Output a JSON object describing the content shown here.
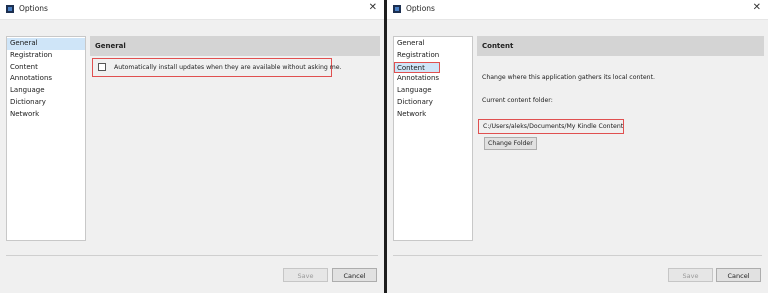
{
  "left_window": {
    "title": "Options",
    "icon": "kindle-app-icon",
    "close_glyph": "✕",
    "nav_items": [
      "General",
      "Registration",
      "Content",
      "Annotations",
      "Language",
      "Dictionary",
      "Network"
    ],
    "selected": "General",
    "panel_title": "General",
    "auto_update_label": "Automatically install updates when they are available without asking me.",
    "auto_update_checked": false,
    "save_label": "Save",
    "cancel_label": "Cancel"
  },
  "right_window": {
    "title": "Options",
    "icon": "kindle-app-icon",
    "close_glyph": "✕",
    "nav_items": [
      "General",
      "Registration",
      "Content",
      "Annotations",
      "Language",
      "Dictionary",
      "Network"
    ],
    "selected": "Content",
    "panel_title": "Content",
    "description": "Change where this application gathers its local content.",
    "current_folder_label": "Current content folder:",
    "current_folder_path": "C:/Users/aleks/Documents/My Kindle Content",
    "change_folder_label": "Change Folder",
    "save_label": "Save",
    "cancel_label": "Cancel"
  },
  "colors": {
    "highlight_outline": "#e05050",
    "selected_item_bg": "#cfe5f8",
    "panel_header_bg": "#d4d4d4",
    "window_bg": "#f0f0f0"
  }
}
